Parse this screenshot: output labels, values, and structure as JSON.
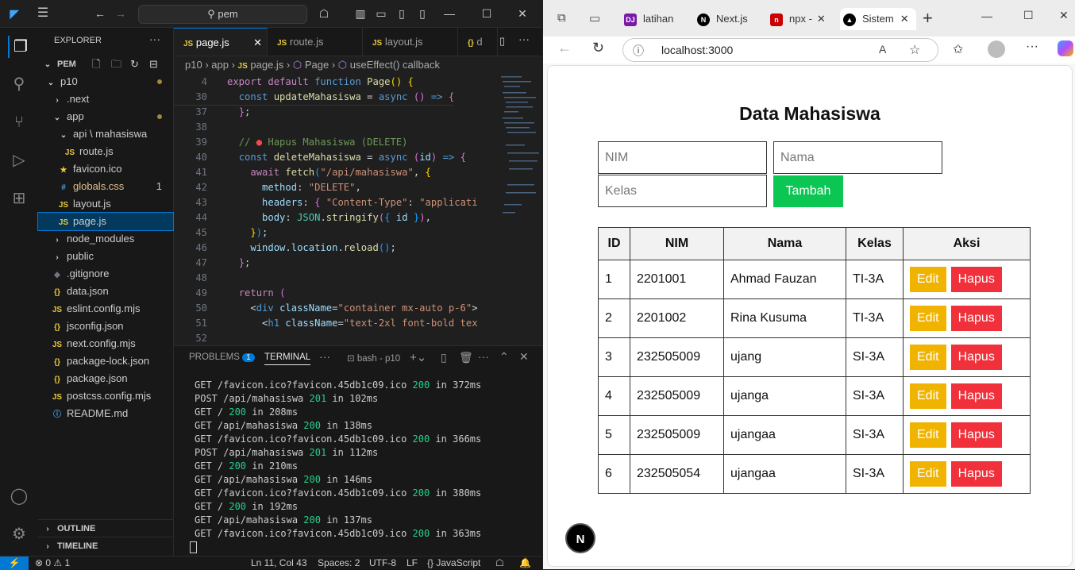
{
  "vscode": {
    "command_center": "pem",
    "explorer": {
      "title": "EXPLORER",
      "root": "PEM",
      "items": [
        {
          "label": "p10",
          "indent": 1,
          "kind": "folder-open"
        },
        {
          "label": ".next",
          "indent": 2,
          "kind": "folder"
        },
        {
          "label": "app",
          "indent": 2,
          "kind": "folder-open"
        },
        {
          "label": "api \\ mahasiswa",
          "indent": 3,
          "kind": "folder-open"
        },
        {
          "label": "route.js",
          "indent": 4,
          "kind": "js"
        },
        {
          "label": "favicon.ico",
          "indent": 3,
          "kind": "star"
        },
        {
          "label": "globals.css",
          "indent": 3,
          "kind": "css",
          "badge": "1"
        },
        {
          "label": "layout.js",
          "indent": 3,
          "kind": "js"
        },
        {
          "label": "page.js",
          "indent": 3,
          "kind": "js"
        },
        {
          "label": "node_modules",
          "indent": 2,
          "kind": "folder"
        },
        {
          "label": "public",
          "indent": 2,
          "kind": "folder"
        },
        {
          "label": ".gitignore",
          "indent": 2,
          "kind": "git"
        },
        {
          "label": "data.json",
          "indent": 2,
          "kind": "json"
        },
        {
          "label": "eslint.config.mjs",
          "indent": 2,
          "kind": "js"
        },
        {
          "label": "jsconfig.json",
          "indent": 2,
          "kind": "json"
        },
        {
          "label": "next.config.mjs",
          "indent": 2,
          "kind": "js"
        },
        {
          "label": "package-lock.json",
          "indent": 2,
          "kind": "json"
        },
        {
          "label": "package.json",
          "indent": 2,
          "kind": "json"
        },
        {
          "label": "postcss.config.mjs",
          "indent": 2,
          "kind": "js"
        },
        {
          "label": "README.md",
          "indent": 2,
          "kind": "info"
        }
      ],
      "outline": "OUTLINE",
      "timeline": "TIMELINE"
    },
    "tabs": [
      "page.js",
      "route.js",
      "layout.js",
      "d"
    ],
    "breadcrumb": [
      "p10",
      "app",
      "page.js",
      "Page",
      "useEffect() callback"
    ],
    "code_lines": [
      "4",
      "30",
      "37",
      "38",
      "39",
      "40",
      "41",
      "42",
      "43",
      "44",
      "45",
      "46",
      "47",
      "48",
      "49",
      "50",
      "51",
      "52"
    ],
    "panel": {
      "problems": "PROBLEMS",
      "problems_count": "1",
      "terminal": "TERMINAL",
      "shell": "bash - p10",
      "lines": [
        {
          "text": "GET /favicon.ico?favicon.45db1c09.ico ",
          "code": "200",
          "time": " in 372ms"
        },
        {
          "text": "POST /api/mahasiswa ",
          "code": "201",
          "time": " in 102ms"
        },
        {
          "text": "GET / ",
          "code": "200",
          "time": " in 208ms"
        },
        {
          "text": "GET /api/mahasiswa ",
          "code": "200",
          "time": " in 138ms"
        },
        {
          "text": "GET /favicon.ico?favicon.45db1c09.ico ",
          "code": "200",
          "time": " in 366ms"
        },
        {
          "text": "POST /api/mahasiswa ",
          "code": "201",
          "time": " in 112ms"
        },
        {
          "text": "GET / ",
          "code": "200",
          "time": " in 210ms"
        },
        {
          "text": "GET /api/mahasiswa ",
          "code": "200",
          "time": " in 146ms"
        },
        {
          "text": "GET /favicon.ico?favicon.45db1c09.ico ",
          "code": "200",
          "time": " in 380ms"
        },
        {
          "text": "GET / ",
          "code": "200",
          "time": " in 192ms"
        },
        {
          "text": "GET /api/mahasiswa ",
          "code": "200",
          "time": " in 137ms"
        },
        {
          "text": "GET /favicon.ico?favicon.45db1c09.ico ",
          "code": "200",
          "time": " in 363ms"
        }
      ]
    },
    "status": {
      "errors": "0",
      "warnings": "1",
      "position": "Ln 11, Col 43",
      "spaces": "Spaces: 2",
      "encoding": "UTF-8",
      "eol": "LF",
      "language": "JavaScript"
    }
  },
  "browser": {
    "tabs": [
      "latihan",
      "Next.js",
      "npx -",
      "Sistem"
    ],
    "url": "localhost:3000",
    "page": {
      "title": "Data Mahasiswa",
      "nim_placeholder": "NIM",
      "nama_placeholder": "Nama",
      "kelas_placeholder": "Kelas",
      "add_button": "Tambah",
      "headers": [
        "ID",
        "NIM",
        "Nama",
        "Kelas",
        "Aksi"
      ],
      "edit_label": "Edit",
      "delete_label": "Hapus",
      "rows": [
        {
          "id": "1",
          "nim": "2201001",
          "nama": "Ahmad Fauzan",
          "kelas": "TI-3A"
        },
        {
          "id": "2",
          "nim": "2201002",
          "nama": "Rina Kusuma",
          "kelas": "TI-3A"
        },
        {
          "id": "3",
          "nim": "232505009",
          "nama": "ujang",
          "kelas": "SI-3A"
        },
        {
          "id": "4",
          "nim": "232505009",
          "nama": "ujanga",
          "kelas": "SI-3A"
        },
        {
          "id": "5",
          "nim": "232505009",
          "nama": "ujangaa",
          "kelas": "SI-3A"
        },
        {
          "id": "6",
          "nim": "232505054",
          "nama": "ujangaa",
          "kelas": "SI-3A"
        }
      ],
      "next_badge": "N"
    }
  }
}
